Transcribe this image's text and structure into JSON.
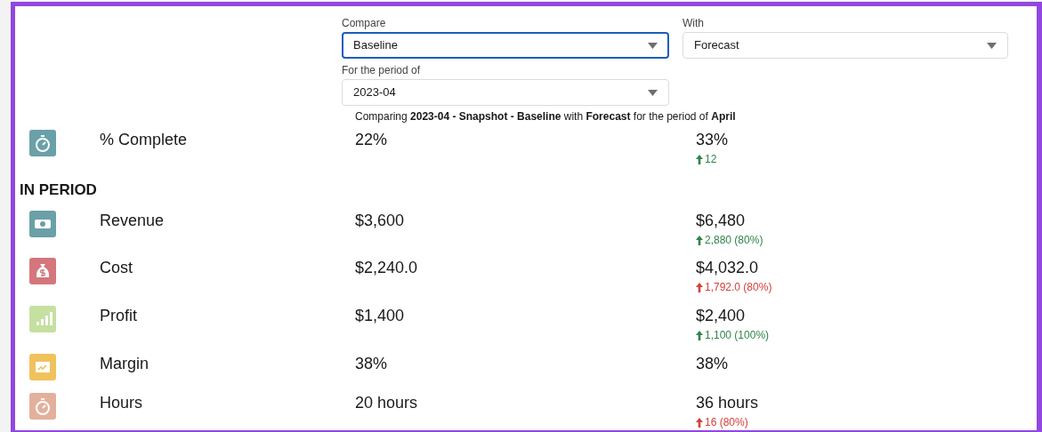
{
  "filters": {
    "compare": {
      "label": "Compare",
      "value": "Baseline",
      "focused": true
    },
    "with": {
      "label": "With",
      "value": "Forecast",
      "focused": false
    },
    "period": {
      "label": "For the period of",
      "value": "2023-04",
      "focused": false
    },
    "summary": "Comparing **2023-04 - Snapshot - Baseline** with **Forecast** for the period of **April**"
  },
  "top_metrics": [
    {
      "kind": "stopwatch",
      "color": "#6aa0a8",
      "label": "% Complete",
      "baseline": "22%",
      "forecast": "33%",
      "delta": "12",
      "favorable": true
    }
  ],
  "section_title": "IN PERIOD",
  "metrics": [
    {
      "kind": "money",
      "color": "#6aa0a8",
      "label": "Revenue",
      "baseline": "$3,600",
      "forecast": "$6,480",
      "delta": "2,880 (80%)",
      "favorable": true
    },
    {
      "kind": "moneybag",
      "color": "#d4767c",
      "label": "Cost",
      "baseline": "$2,240.0",
      "forecast": "$4,032.0",
      "delta": "1,792.0 (80%)",
      "favorable": false
    },
    {
      "kind": "bars",
      "color": "#c5e0a0",
      "label": "Profit",
      "baseline": "$1,400",
      "forecast": "$2,400",
      "delta": "1,100 (100%)",
      "favorable": true
    },
    {
      "kind": "chart",
      "color": "#f0c25c",
      "label": "Margin",
      "baseline": "38%",
      "forecast": "38%"
    },
    {
      "kind": "stopwatch",
      "color": "#e3b09c",
      "label": "Hours",
      "baseline": "20 hours",
      "forecast": "36 hours",
      "delta": "16 (80%)",
      "favorable": false
    }
  ]
}
